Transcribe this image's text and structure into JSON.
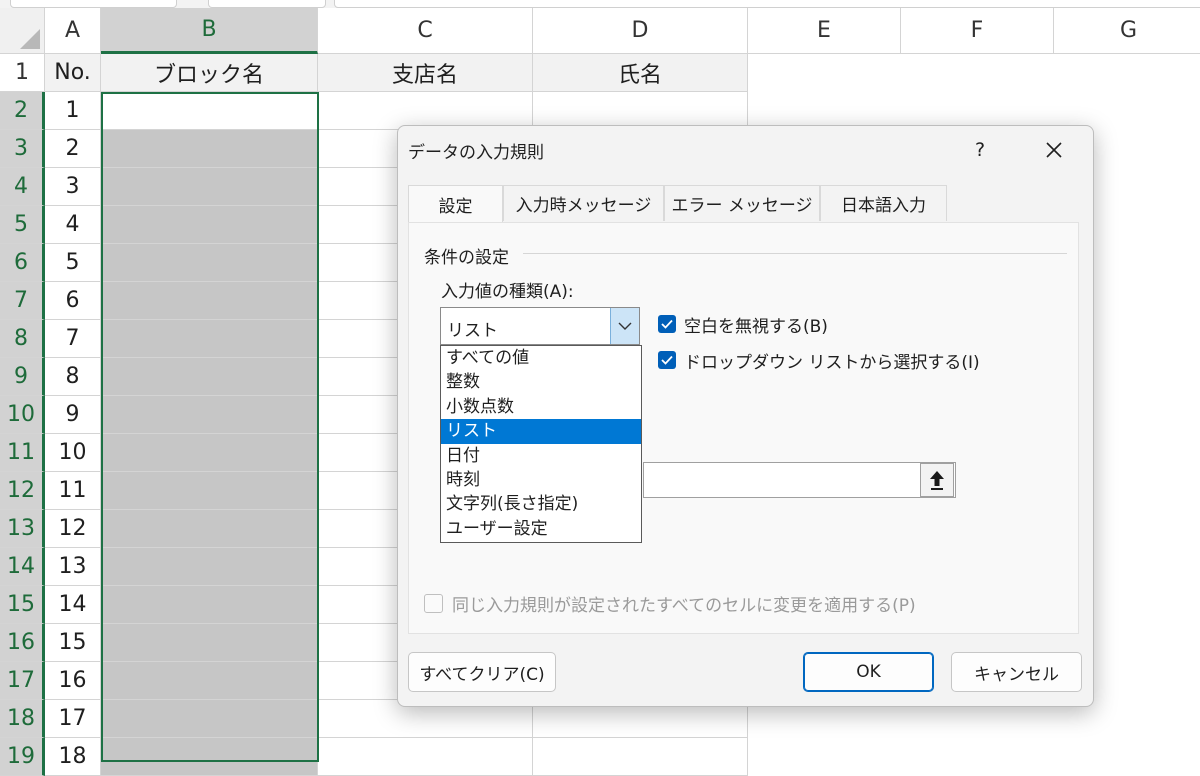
{
  "colors": {
    "accent": "#0078d4",
    "selection_green": "#1e7145",
    "checkbox": "#005fb8"
  },
  "sheet": {
    "columns": [
      "A",
      "B",
      "C",
      "D",
      "E",
      "F",
      "G"
    ],
    "rows": [
      "1",
      "2",
      "3",
      "4",
      "5",
      "6",
      "7",
      "8",
      "9",
      "10",
      "11",
      "12",
      "13",
      "14",
      "15",
      "16",
      "17",
      "18",
      "19"
    ],
    "header_row": [
      "No.",
      "ブロック名",
      "支店名",
      "氏名"
    ],
    "numbers": [
      "1",
      "2",
      "3",
      "4",
      "5",
      "6",
      "7",
      "8",
      "9",
      "10",
      "11",
      "12",
      "13",
      "14",
      "15",
      "16",
      "17",
      "18"
    ]
  },
  "dialog": {
    "title": "データの入力規則",
    "help": "?",
    "tabs": [
      "設定",
      "入力時メッセージ",
      "エラー メッセージ",
      "日本語入力"
    ],
    "group_label": "条件の設定",
    "allow_label": "入力値の種類(A):",
    "allow_value": "リスト",
    "allow_options": [
      "すべての値",
      "整数",
      "小数点数",
      "リスト",
      "日付",
      "時刻",
      "文字列(長さ指定)",
      "ユーザー設定"
    ],
    "ignore_blank": "空白を無視する(B)",
    "in_cell_dropdown": "ドロップダウン リストから選択する(I)",
    "apply_all": "同じ入力規則が設定されたすべてのセルに変更を適用する(P)",
    "clear_all": "すべてクリア(C)",
    "ok": "OK",
    "cancel": "キャンセル"
  }
}
